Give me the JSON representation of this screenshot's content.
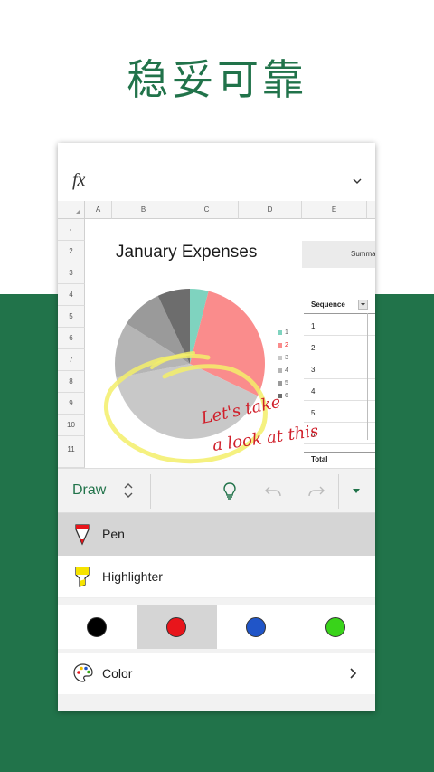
{
  "headline": "稳妥可靠",
  "formula_bar": {
    "fx_label": "fx"
  },
  "columns": [
    "A",
    "B",
    "C",
    "D",
    "E"
  ],
  "rows": [
    "1",
    "2",
    "3",
    "4",
    "5",
    "6",
    "7",
    "8",
    "9",
    "10",
    "11"
  ],
  "sheet": {
    "chart_title": "January Expenses",
    "summary_label": "Summa",
    "table_header": "Sequence",
    "sequence_values": [
      "1",
      "2",
      "3",
      "4",
      "5",
      "6"
    ],
    "total_label": "Total"
  },
  "chart_data": {
    "type": "pie",
    "title": "January Expenses",
    "series": [
      {
        "name": "1",
        "value": 4,
        "color": "#7fd3bf"
      },
      {
        "name": "2",
        "value": 28,
        "color": "#fa8c8c"
      },
      {
        "name": "3",
        "value": 40,
        "color": "#c8c8c8"
      },
      {
        "name": "4",
        "value": 12,
        "color": "#b5b5b5"
      },
      {
        "name": "5",
        "value": 9,
        "color": "#9a9a9a"
      },
      {
        "name": "6",
        "value": 7,
        "color": "#6d6d6d"
      }
    ],
    "legend_position": "right"
  },
  "ink_annotation": {
    "line1": "Let's take",
    "line2": "a look at this"
  },
  "toolbar": {
    "mode_label": "Draw"
  },
  "tools": {
    "pen_label": "Pen",
    "highlighter_label": "Highlighter"
  },
  "swatches": [
    {
      "name": "black",
      "color": "#000000"
    },
    {
      "name": "red",
      "color": "#e8151b"
    },
    {
      "name": "blue",
      "color": "#2055c8"
    },
    {
      "name": "green",
      "color": "#39d31a"
    }
  ],
  "color_option": {
    "label": "Color"
  },
  "colors": {
    "brand_green": "#21734a",
    "ink_red": "#d01f2a",
    "highlight_yellow": "#f3ef6a"
  }
}
